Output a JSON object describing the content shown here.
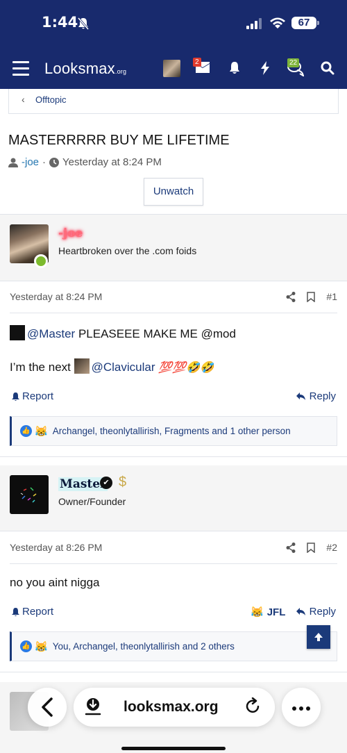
{
  "status": {
    "time": "1:44",
    "battery": "67"
  },
  "nav": {
    "logo_main": "Looksmax",
    "logo_suffix": ".org",
    "inbox_badge": "2",
    "alerts_badge": "22"
  },
  "breadcrumb": {
    "label": "Offtopic"
  },
  "thread": {
    "title": "MASTERRRRR BUY ME LIFETIME",
    "author": "-joe",
    "date": "Yesterday at 8:24 PM",
    "watch_label": "Unwatch"
  },
  "posts": [
    {
      "username": "-joe",
      "user_title": "Heartbroken over the .com foids",
      "date": "Yesterday at 8:24 PM",
      "number": "#1",
      "body_line1_mention": "@Master",
      "body_line1_text": " PLEASEEE MAKE ME @mod",
      "body_line2_text": "I’m the next ",
      "body_line2_mention": "@Clavicular",
      "body_line2_emoji": "💯💯🤣🤣",
      "report_label": "Report",
      "reply_label": "Reply",
      "reactions": "Archangel, theonlytallirish, Fragments and 1 other person"
    },
    {
      "username": "Master",
      "user_title": "Owner/Founder",
      "date": "Yesterday at 8:26 PM",
      "number": "#2",
      "body": "no you aint nigga",
      "report_label": "Report",
      "jfl_label": "JFL",
      "reply_label": "Reply",
      "reactions": "You, Archangel, theonlytallirish and 2 others"
    }
  ],
  "browser": {
    "url": "looksmax.org"
  },
  "colors": {
    "navbar": "#182a6d",
    "link": "#1b3a7a",
    "online": "#7dbb2e"
  }
}
